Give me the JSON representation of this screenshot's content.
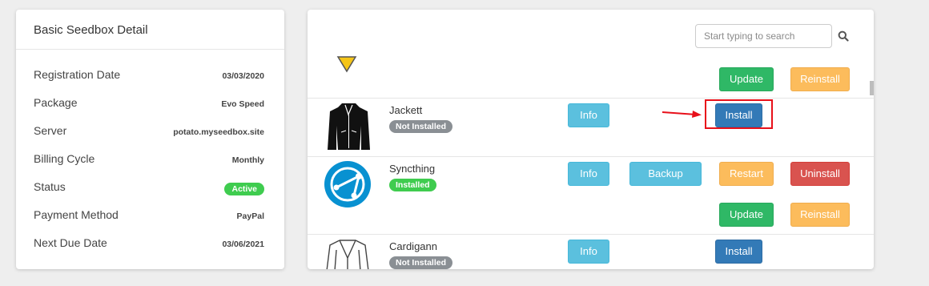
{
  "detail": {
    "title": "Basic Seedbox Detail",
    "rows": [
      {
        "label": "Registration Date",
        "value": "03/03/2020"
      },
      {
        "label": "Package",
        "value": "Evo Speed"
      },
      {
        "label": "Server",
        "value": "potato.myseedbox.site"
      },
      {
        "label": "Billing Cycle",
        "value": "Monthly"
      },
      {
        "label": "Status",
        "value": "Active"
      },
      {
        "label": "Payment Method",
        "value": "PayPal"
      },
      {
        "label": "Next Due Date",
        "value": "03/06/2021"
      }
    ]
  },
  "search": {
    "placeholder": "Start typing to search"
  },
  "top_row": {
    "update_label": "Update",
    "reinstall_label": "Reinstall"
  },
  "apps": [
    {
      "name": "Jackett",
      "status": "Not Installed",
      "info_label": "Info",
      "install_label": "Install"
    },
    {
      "name": "Syncthing",
      "status": "Installed",
      "info_label": "Info",
      "backup_label": "Backup",
      "restart_label": "Restart",
      "uninstall_label": "Uninstall",
      "update_label": "Update",
      "reinstall_label": "Reinstall"
    },
    {
      "name": "Cardigann",
      "status": "Not Installed",
      "info_label": "Info",
      "install_label": "Install"
    }
  ],
  "colors": {
    "annotation": "#e8101a",
    "installed": "#3fcc4f",
    "not_installed": "#8a8f94"
  }
}
